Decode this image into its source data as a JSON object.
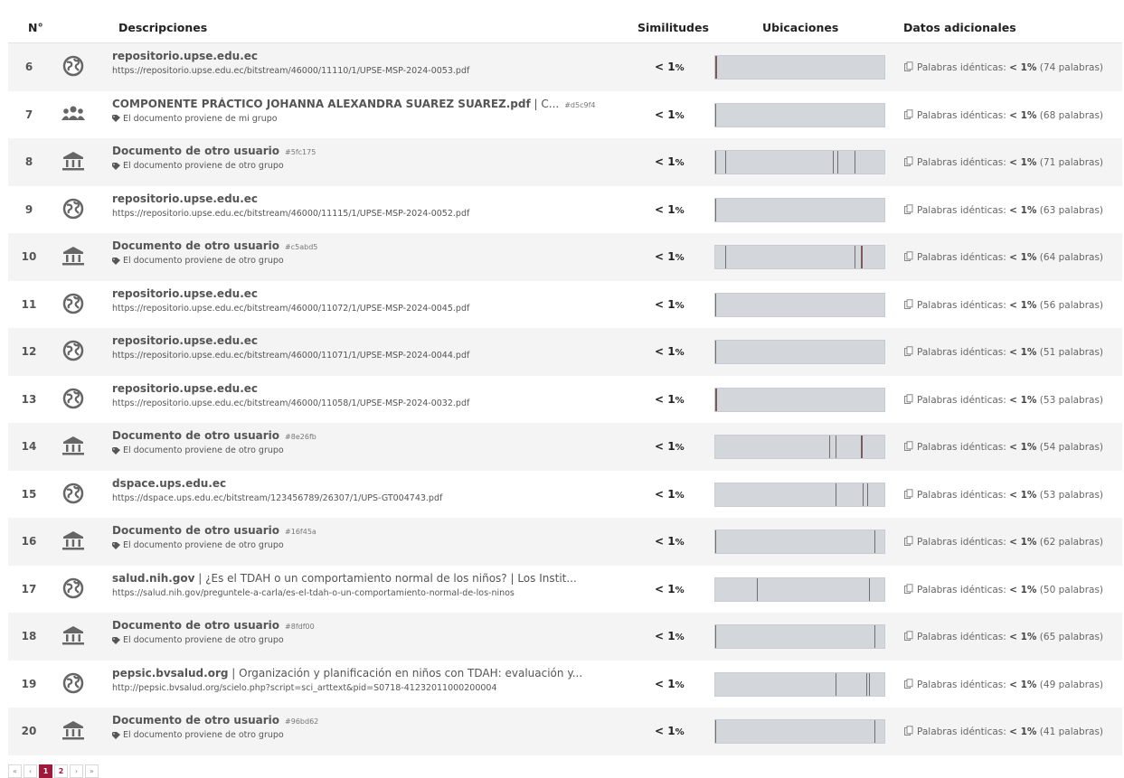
{
  "headers": {
    "num": "N°",
    "desc": "Descripciones",
    "sim": "Similitudes",
    "loc": "Ubicaciones",
    "extra": "Datos adicionales"
  },
  "extra_label": "Palabras idénticas:",
  "rows": [
    {
      "n": "6",
      "icon": "globe-icon",
      "title": "repositorio.upse.edu.ec",
      "title_ext": "",
      "hash": "",
      "sub": "https://repositorio.upse.edu.ec/bitstream/46000/11110/1/UPSE-MSP-2024-0053.pdf",
      "sub_tag": false,
      "sim_lt": "< 1",
      "sim_pct": "%",
      "markers": [
        {
          "at": 0.0,
          "thick": true
        }
      ],
      "extra_pct": "< 1%",
      "extra_words": "(74 palabras)"
    },
    {
      "n": "7",
      "icon": "group-icon",
      "title": "COMPONENTE PRÁCTICO JOHANNA ALEXANDRA SUAREZ SUAREZ.pdf",
      "title_ext": " | C...",
      "hash": "#d5c9f4",
      "sub": "El documento proviene de mi grupo",
      "sub_tag": true,
      "sim_lt": "< 1",
      "sim_pct": "%",
      "markers": [
        {
          "at": 0.0,
          "thick": false
        }
      ],
      "extra_pct": "< 1%",
      "extra_words": "(68 palabras)"
    },
    {
      "n": "8",
      "icon": "institution-icon",
      "title": "Documento de otro usuario",
      "title_ext": "",
      "hash": "#5fc175",
      "sub": "El documento proviene de otro grupo",
      "sub_tag": true,
      "sim_lt": "< 1",
      "sim_pct": "%",
      "markers": [
        {
          "at": 0.0,
          "thick": false
        },
        {
          "at": 0.06,
          "thick": false
        },
        {
          "at": 0.7,
          "thick": false
        },
        {
          "at": 0.73,
          "thick": false
        },
        {
          "at": 0.83,
          "thick": false
        }
      ],
      "extra_pct": "< 1%",
      "extra_words": "(71 palabras)"
    },
    {
      "n": "9",
      "icon": "globe-icon",
      "title": "repositorio.upse.edu.ec",
      "title_ext": "",
      "hash": "",
      "sub": "https://repositorio.upse.edu.ec/bitstream/46000/11115/1/UPSE-MSP-2024-0052.pdf",
      "sub_tag": false,
      "sim_lt": "< 1",
      "sim_pct": "%",
      "markers": [
        {
          "at": 0.0,
          "thick": false
        }
      ],
      "extra_pct": "< 1%",
      "extra_words": "(63 palabras)"
    },
    {
      "n": "10",
      "icon": "institution-icon",
      "title": "Documento de otro usuario",
      "title_ext": "",
      "hash": "#c5abd5",
      "sub": "El documento proviene de otro grupo",
      "sub_tag": true,
      "sim_lt": "< 1",
      "sim_pct": "%",
      "markers": [
        {
          "at": 0.06,
          "thick": false
        },
        {
          "at": 0.83,
          "thick": false
        },
        {
          "at": 0.87,
          "thick": true
        }
      ],
      "extra_pct": "< 1%",
      "extra_words": "(64 palabras)"
    },
    {
      "n": "11",
      "icon": "globe-icon",
      "title": "repositorio.upse.edu.ec",
      "title_ext": "",
      "hash": "",
      "sub": "https://repositorio.upse.edu.ec/bitstream/46000/11072/1/UPSE-MSP-2024-0045.pdf",
      "sub_tag": false,
      "sim_lt": "< 1",
      "sim_pct": "%",
      "markers": [
        {
          "at": 0.0,
          "thick": false
        }
      ],
      "extra_pct": "< 1%",
      "extra_words": "(56 palabras)"
    },
    {
      "n": "12",
      "icon": "globe-icon",
      "title": "repositorio.upse.edu.ec",
      "title_ext": "",
      "hash": "",
      "sub": "https://repositorio.upse.edu.ec/bitstream/46000/11071/1/UPSE-MSP-2024-0044.pdf",
      "sub_tag": false,
      "sim_lt": "< 1",
      "sim_pct": "%",
      "markers": [
        {
          "at": 0.0,
          "thick": false
        }
      ],
      "extra_pct": "< 1%",
      "extra_words": "(51 palabras)"
    },
    {
      "n": "13",
      "icon": "globe-icon",
      "title": "repositorio.upse.edu.ec",
      "title_ext": "",
      "hash": "",
      "sub": "https://repositorio.upse.edu.ec/bitstream/46000/11058/1/UPSE-MSP-2024-0032.pdf",
      "sub_tag": false,
      "sim_lt": "< 1",
      "sim_pct": "%",
      "markers": [
        {
          "at": 0.0,
          "thick": true
        }
      ],
      "extra_pct": "< 1%",
      "extra_words": "(53 palabras)"
    },
    {
      "n": "14",
      "icon": "institution-icon",
      "title": "Documento de otro usuario",
      "title_ext": "",
      "hash": "#8e26fb",
      "sub": "El documento proviene de otro grupo",
      "sub_tag": true,
      "sim_lt": "< 1",
      "sim_pct": "%",
      "markers": [
        {
          "at": 0.68,
          "thick": false
        },
        {
          "at": 0.72,
          "thick": false
        },
        {
          "at": 0.87,
          "thick": true
        }
      ],
      "extra_pct": "< 1%",
      "extra_words": "(54 palabras)"
    },
    {
      "n": "15",
      "icon": "globe-icon",
      "title": "dspace.ups.edu.ec",
      "title_ext": "",
      "hash": "",
      "sub": "https://dspace.ups.edu.ec/bitstream/123456789/26307/1/UPS-GT004743.pdf",
      "sub_tag": false,
      "sim_lt": "< 1",
      "sim_pct": "%",
      "markers": [
        {
          "at": 0.72,
          "thick": false
        },
        {
          "at": 0.88,
          "thick": false
        },
        {
          "at": 0.91,
          "thick": false
        }
      ],
      "extra_pct": "< 1%",
      "extra_words": "(53 palabras)"
    },
    {
      "n": "16",
      "icon": "institution-icon",
      "title": "Documento de otro usuario",
      "title_ext": "",
      "hash": "#16f45a",
      "sub": "El documento proviene de otro grupo",
      "sub_tag": true,
      "sim_lt": "< 1",
      "sim_pct": "%",
      "markers": [
        {
          "at": 0.0,
          "thick": false
        },
        {
          "at": 0.95,
          "thick": false
        }
      ],
      "extra_pct": "< 1%",
      "extra_words": "(62 palabras)"
    },
    {
      "n": "17",
      "icon": "globe-icon",
      "title": "salud.nih.gov",
      "title_ext": " | ¿Es el TDAH o un comportamiento normal de los niños? | Los Instit...",
      "hash": "",
      "sub": "https://salud.nih.gov/preguntele-a-carla/es-el-tdah-o-un-comportamiento-normal-de-los-ninos",
      "sub_tag": false,
      "sim_lt": "< 1",
      "sim_pct": "%",
      "markers": [
        {
          "at": 0.25,
          "thick": false
        },
        {
          "at": 0.92,
          "thick": false
        }
      ],
      "extra_pct": "< 1%",
      "extra_words": "(50 palabras)"
    },
    {
      "n": "18",
      "icon": "institution-icon",
      "title": "Documento de otro usuario",
      "title_ext": "",
      "hash": "#8fdf00",
      "sub": "El documento proviene de otro grupo",
      "sub_tag": true,
      "sim_lt": "< 1",
      "sim_pct": "%",
      "markers": [
        {
          "at": 0.0,
          "thick": false
        },
        {
          "at": 0.95,
          "thick": false
        }
      ],
      "extra_pct": "< 1%",
      "extra_words": "(65 palabras)"
    },
    {
      "n": "19",
      "icon": "globe-icon",
      "title": "pepsic.bvsalud.org",
      "title_ext": " | Organización y planificación en niños con TDAH: evaluación y...",
      "hash": "",
      "sub": "http://pepsic.bvsalud.org/scielo.php?script=sci_arttext&pid=S0718-41232011000200004",
      "sub_tag": false,
      "sim_lt": "< 1",
      "sim_pct": "%",
      "markers": [
        {
          "at": 0.72,
          "thick": false
        },
        {
          "at": 0.9,
          "thick": false
        },
        {
          "at": 0.92,
          "thick": false
        }
      ],
      "extra_pct": "< 1%",
      "extra_words": "(49 palabras)"
    },
    {
      "n": "20",
      "icon": "institution-icon",
      "title": "Documento de otro usuario",
      "title_ext": "",
      "hash": "#96bd62",
      "sub": "El documento proviene de otro grupo",
      "sub_tag": true,
      "sim_lt": "< 1",
      "sim_pct": "%",
      "markers": [
        {
          "at": 0.0,
          "thick": false
        },
        {
          "at": 0.95,
          "thick": false
        }
      ],
      "extra_pct": "< 1%",
      "extra_words": "(41 palabras)"
    }
  ],
  "pagination": {
    "first": "«",
    "prev": "‹",
    "pages": [
      "1",
      "2"
    ],
    "active": "1",
    "next": "›",
    "last": "»"
  },
  "colors": {
    "accent": "#a0193a",
    "bar_bg": "#d3d6da",
    "marker": "#6f6f6f",
    "row_alt": "#f4f4f4"
  }
}
